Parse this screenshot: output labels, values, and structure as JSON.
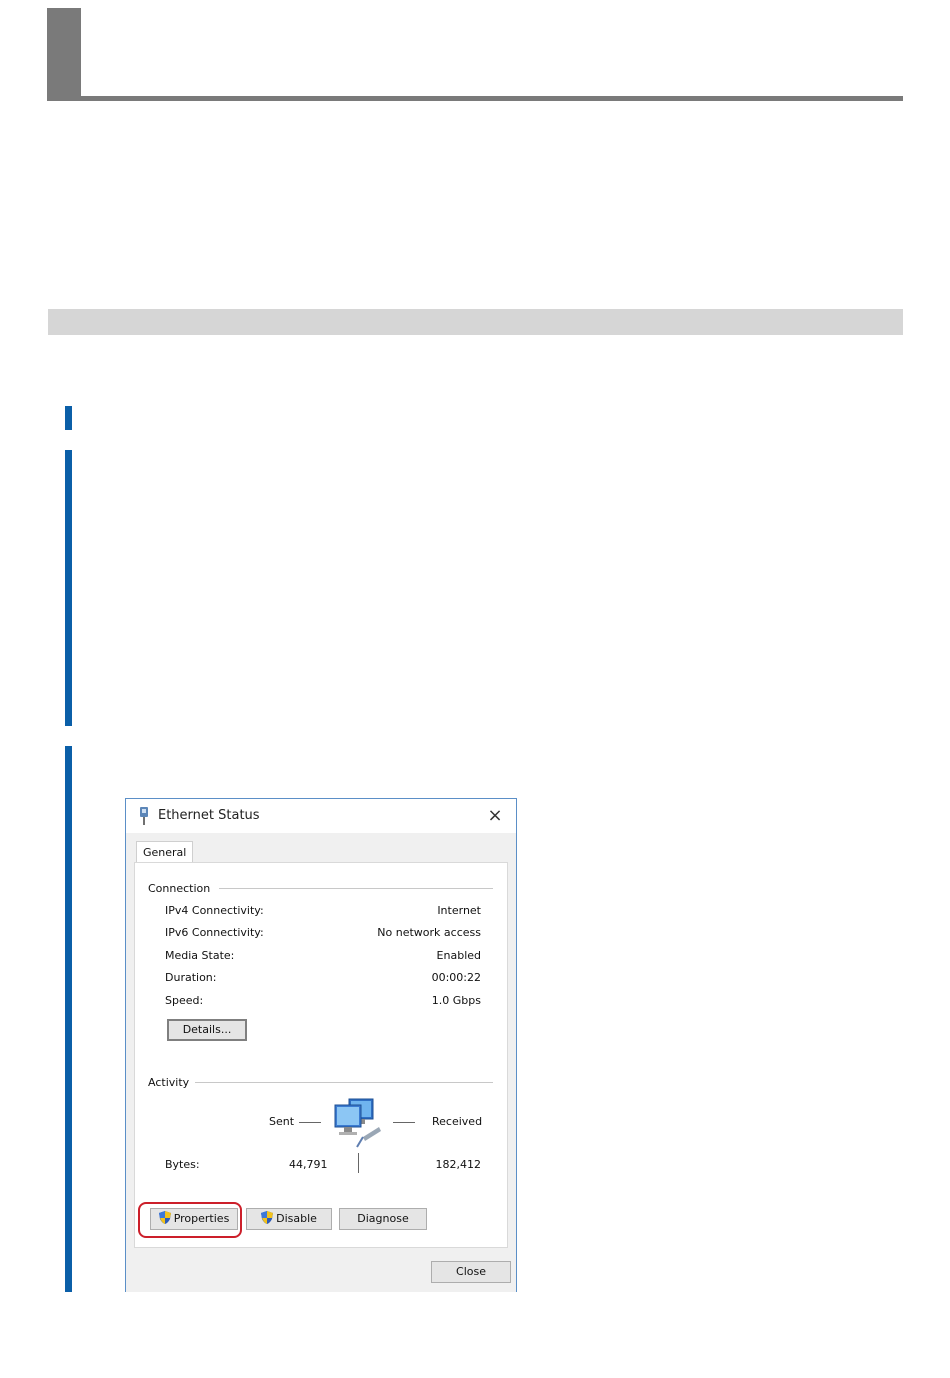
{
  "dialog": {
    "title": "Ethernet Status",
    "close_glyph": "×",
    "tab_label": "General",
    "connection": {
      "label": "Connection",
      "rows": [
        {
          "label": "IPv4 Connectivity:",
          "value": "Internet"
        },
        {
          "label": "IPv6 Connectivity:",
          "value": "No network access"
        },
        {
          "label": "Media State:",
          "value": "Enabled"
        },
        {
          "label": "Duration:",
          "value": "00:00:22"
        },
        {
          "label": "Speed:",
          "value": "1.0 Gbps"
        }
      ],
      "details_button": "Details..."
    },
    "activity": {
      "label": "Activity",
      "sent_label": "Sent",
      "received_label": "Received",
      "bytes_label": "Bytes:",
      "bytes_sent": "44,791",
      "bytes_received": "182,412"
    },
    "buttons": {
      "properties": "Properties",
      "disable": "Disable",
      "diagnose": "Diagnose",
      "close": "Close"
    }
  },
  "icons": {
    "title": "ethernet-plug-icon",
    "network": "network-computers-icon",
    "shield": "uac-shield-icon"
  },
  "colors": {
    "step_bar": "#0b5fa8",
    "highlight": "#cc1f2a",
    "header_gray": "#7a7a7a",
    "section_band": "#d6d6d6"
  }
}
